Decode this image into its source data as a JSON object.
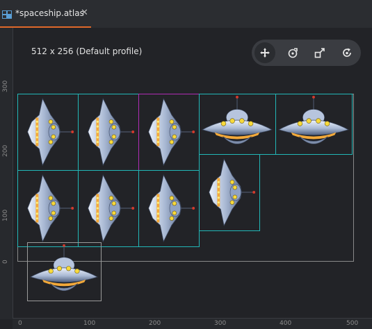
{
  "tab": {
    "title": "*spaceship.atlas",
    "close_glyph": "✕",
    "icon": "atlas-icon"
  },
  "canvas": {
    "profile_label": "512 x 256 (Default profile)"
  },
  "toolbar": {
    "buttons": [
      {
        "icon": "move-icon",
        "active": true
      },
      {
        "icon": "rotate-icon",
        "active": false
      },
      {
        "icon": "scale-icon",
        "active": false
      },
      {
        "icon": "reset-view-icon",
        "active": false
      }
    ]
  },
  "rulers": {
    "left_labels": [
      "300",
      "200",
      "100",
      "0"
    ],
    "bottom_labels": [
      "0",
      "100",
      "200",
      "300",
      "400",
      "500"
    ]
  },
  "colors": {
    "accent": "#e0692a",
    "sprite_border": "#22b8b8",
    "selected_border": "#b12db5"
  },
  "sprites": [
    {
      "view": "side"
    },
    {
      "view": "side"
    },
    {
      "view": "side",
      "selected": true
    },
    {
      "view": "front"
    },
    {
      "view": "front"
    },
    {
      "view": "side"
    },
    {
      "view": "side"
    },
    {
      "view": "side"
    },
    {
      "view": "side"
    },
    {
      "view": "front",
      "outside": true
    }
  ]
}
